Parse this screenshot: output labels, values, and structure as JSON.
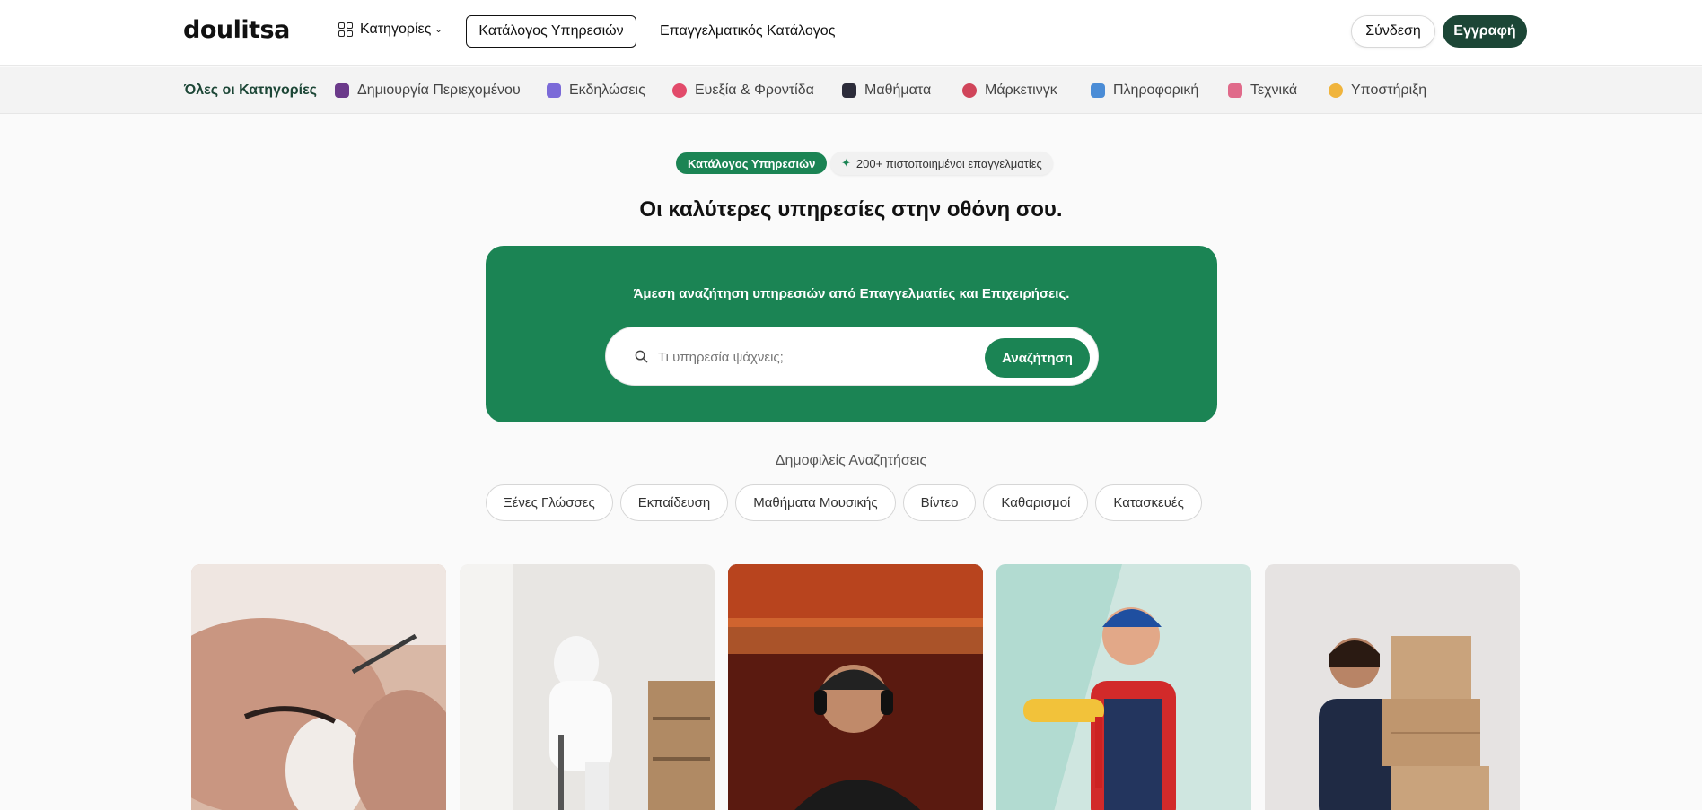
{
  "header": {
    "logo": "doulitsa",
    "categories_label": "Κατηγορίες",
    "services_catalog": "Κατάλογος Υπηρεσιών",
    "pro_catalog": "Επαγγελματικός Κατάλογος",
    "login": "Σύνδεση",
    "signup": "Εγγραφή"
  },
  "category_bar": {
    "items": [
      {
        "label": "Όλες οι Κατηγορίες",
        "icon": ""
      },
      {
        "label": "Δημιουργία Περιεχομένου",
        "icon": "camera-icon"
      },
      {
        "label": "Εκδηλώσεις",
        "icon": "music-note-icon"
      },
      {
        "label": "Ευεξία & Φροντίδα",
        "icon": "heart-icon"
      },
      {
        "label": "Μαθήματα",
        "icon": "graduation-cap-icon"
      },
      {
        "label": "Μάρκετινγκ",
        "icon": "target-icon"
      },
      {
        "label": "Πληροφορική",
        "icon": "computer-icon"
      },
      {
        "label": "Τεχνικά",
        "icon": "brush-icon"
      },
      {
        "label": "Υποστήριξη",
        "icon": "handshake-icon"
      }
    ]
  },
  "hero": {
    "badge": "Κατάλογος Υπηρεσιών",
    "pro_count": "200+ πιστοποιημένοι επαγγελματίες",
    "title": "Οι καλύτερες υπηρεσίες στην οθόνη σου.",
    "panel_text": "Άμεση αναζήτηση υπηρεσιών από Επαγγελματίες και Επιχειρήσεις.",
    "search_placeholder": "Τι υπηρεσία ψάχνεις;",
    "search_button": "Αναζήτηση"
  },
  "popular": {
    "label": "Δημοφιλείς Αναζητήσεις",
    "chips": [
      "Ξένες Γλώσσες",
      "Εκπαίδευση",
      "Μαθήματα Μουσικής",
      "Βίντεο",
      "Καθαρισμοί",
      "Κατασκευές"
    ]
  },
  "colors": {
    "brand_green": "#1b8454",
    "dark_green": "#1c4636"
  }
}
